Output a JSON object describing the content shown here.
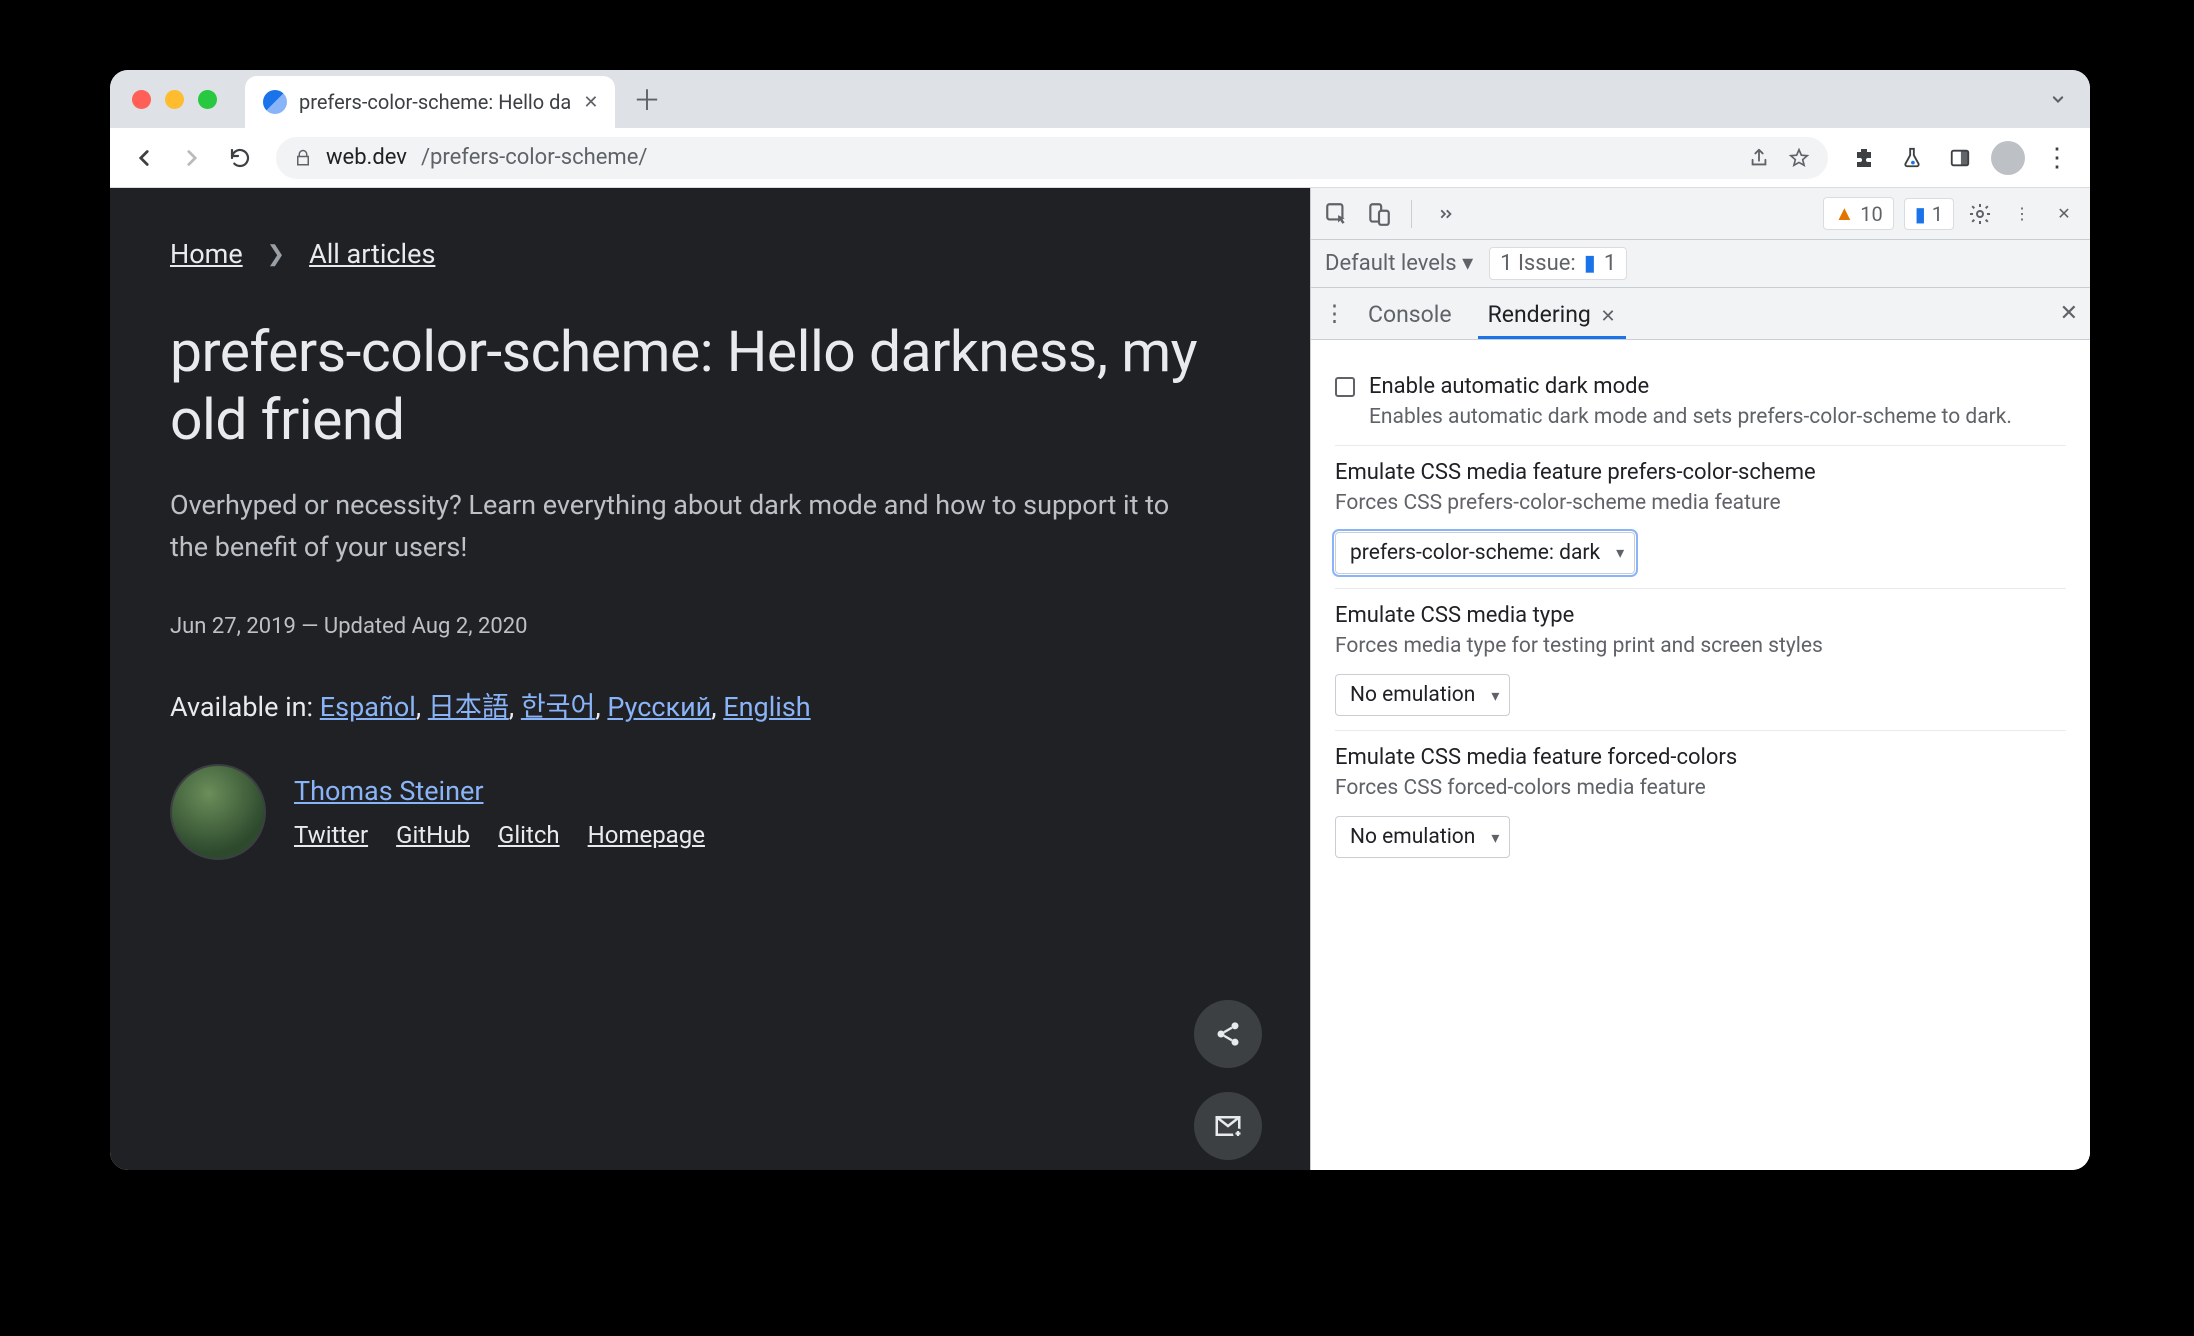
{
  "browser": {
    "tab_title": "prefers-color-scheme: Hello da",
    "url_domain": "web.dev",
    "url_path": "/prefers-color-scheme/"
  },
  "page": {
    "breadcrumbs": {
      "home": "Home",
      "all_articles": "All articles"
    },
    "title": "prefers-color-scheme: Hello darkness, my old friend",
    "subtitle": "Overhyped or necessity? Learn everything about dark mode and how to support it to the benefit of your users!",
    "dateline": "Jun 27, 2019 — Updated Aug 2, 2020",
    "available_label": "Available in: ",
    "langs": [
      "Español",
      "日本語",
      "한국어",
      "Русский",
      "English"
    ],
    "author": {
      "name": "Thomas Steiner",
      "links": [
        "Twitter",
        "GitHub",
        "Glitch",
        "Homepage"
      ]
    }
  },
  "devtools": {
    "warnings": "10",
    "infos": "1",
    "levels_label": "Default levels ▾",
    "issues_label": "1 Issue:",
    "issues_count": "1",
    "drawer": {
      "console": "Console",
      "rendering": "Rendering"
    },
    "opts": {
      "dark_title": "Enable automatic dark mode",
      "dark_desc": "Enables automatic dark mode and sets prefers-color-scheme to dark.",
      "pcs_title": "Emulate CSS media feature prefers-color-scheme",
      "pcs_desc": "Forces CSS prefers-color-scheme media feature",
      "pcs_value": "prefers-color-scheme: dark",
      "media_title": "Emulate CSS media type",
      "media_desc": "Forces media type for testing print and screen styles",
      "media_value": "No emulation",
      "fc_title": "Emulate CSS media feature forced-colors",
      "fc_desc": "Forces CSS forced-colors media feature",
      "fc_value": "No emulation"
    }
  }
}
